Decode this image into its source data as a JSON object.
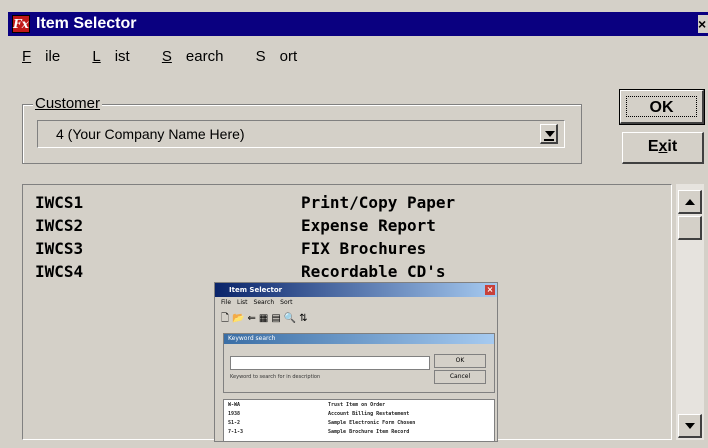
{
  "window": {
    "title": "Item Selector",
    "close_glyph": "×",
    "app_icon_glyph": "Fx"
  },
  "menu": [
    {
      "accel": "F",
      "rest": "ile"
    },
    {
      "accel": "L",
      "rest": "ist"
    },
    {
      "accel": "S",
      "rest": "earch"
    },
    {
      "accel": "S",
      "rest": "ort",
      "plain_first": true
    }
  ],
  "customer": {
    "label": "Customer",
    "value": "4 (Your Company Name Here)"
  },
  "buttons": {
    "ok": "OK",
    "exit_pre": "E",
    "exit_accel": "x",
    "exit_post": "it"
  },
  "items": [
    {
      "code": "IWCS1",
      "desc": "Print/Copy Paper"
    },
    {
      "code": "IWCS2",
      "desc": "Expense Report"
    },
    {
      "code": "IWCS3",
      "desc": "FIX Brochures"
    },
    {
      "code": "IWCS4",
      "desc": "Recordable CD's"
    }
  ],
  "embedded": {
    "title": "Item Selector",
    "menu": [
      "File",
      "List",
      "Search",
      "Sort"
    ],
    "toolbar": [
      "🗋",
      "📂",
      "⇐",
      "▦",
      "▤",
      "🔍",
      "⇅"
    ],
    "panel_header": "Keyword search",
    "ok": "OK",
    "cancel": "Cancel",
    "hint": "Keyword to search for in description",
    "rows": [
      {
        "code": "W-WA",
        "desc": "Trust Item on Order"
      },
      {
        "code": "1938",
        "desc": "Account Billing Restatement"
      },
      {
        "code": "S1-2",
        "desc": "Sample Electronic Form Chosen"
      },
      {
        "code": "7-1-3",
        "desc": "Sample Brochure Item Record"
      }
    ]
  },
  "colors": {
    "titlebar": "#0a0080",
    "face": "#d4d0c8"
  }
}
